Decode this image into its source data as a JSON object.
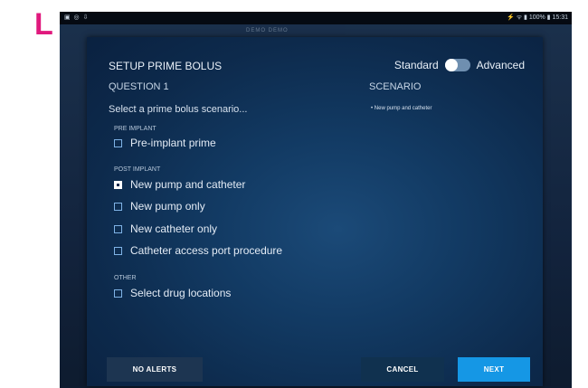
{
  "figure": {
    "panel_letter": "L"
  },
  "status_bar": {
    "left_icons": "▣ ◎ ⇩",
    "right_text": "⚡ ᯤ ▮ 100% ▮ 15:31"
  },
  "background": {
    "ghost_text": "DEMO DEMO"
  },
  "dialog": {
    "title": "SETUP PRIME BOLUS",
    "mode_toggle": {
      "left_label": "Standard",
      "right_label": "Advanced",
      "selected": "Standard"
    },
    "question_label": "QUESTION 1",
    "scenario_heading": "SCENARIO",
    "scenario_item": "• New pump and catheter",
    "prompt": "Select a prime bolus scenario...",
    "sections": [
      {
        "label": "PRE IMPLANT"
      },
      {
        "label": "POST IMPLANT"
      },
      {
        "label": "OTHER"
      }
    ],
    "options": [
      {
        "label": "Pre-implant prime",
        "checked": false
      },
      {
        "label": "New pump and catheter",
        "checked": true
      },
      {
        "label": "New pump only",
        "checked": false
      },
      {
        "label": "New catheter only",
        "checked": false
      },
      {
        "label": "Catheter access port procedure",
        "checked": false
      },
      {
        "label": "Select drug locations",
        "checked": false
      }
    ],
    "buttons": {
      "no_alerts": "NO ALERTS",
      "cancel": "CANCEL",
      "next": "NEXT"
    }
  },
  "colors": {
    "panel_letter": "#e0197d",
    "dialog_bg": "#123a63",
    "next_button": "#1597e5",
    "checkbox_border": "#7fb3e6"
  }
}
